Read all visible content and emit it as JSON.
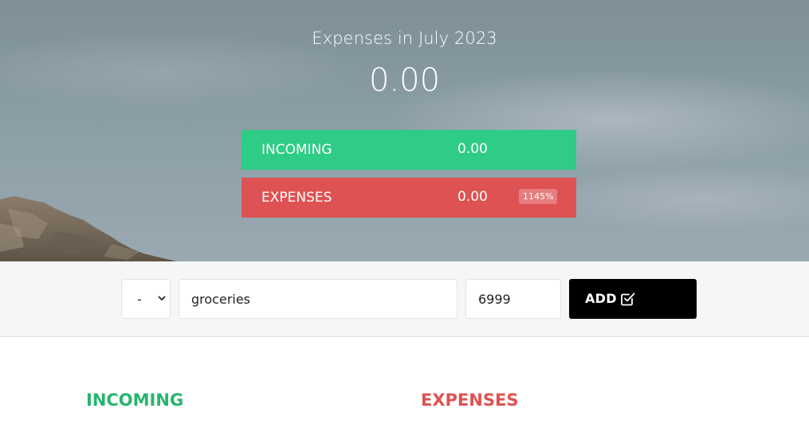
{
  "header": {
    "title": "Expenses in July 2023",
    "total": "0.00"
  },
  "summary": {
    "incoming": {
      "label": "INCOMING",
      "value": "0.00"
    },
    "expenses": {
      "label": "EXPENSES",
      "value": "0.00",
      "percentage": "1145%"
    }
  },
  "form": {
    "type_select_value": "-",
    "description_value": "groceries",
    "amount_value": "6999",
    "add_label": "ADD",
    "add_icon": "check-square-icon"
  },
  "lists": {
    "incoming_title": "INCOMING",
    "expenses_title": "EXPENSES"
  },
  "colors": {
    "income": "#2ecc84",
    "expense": "#df5253",
    "income_title": "#28b46e",
    "button": "#000000",
    "form_bar": "#f6f6f6"
  }
}
